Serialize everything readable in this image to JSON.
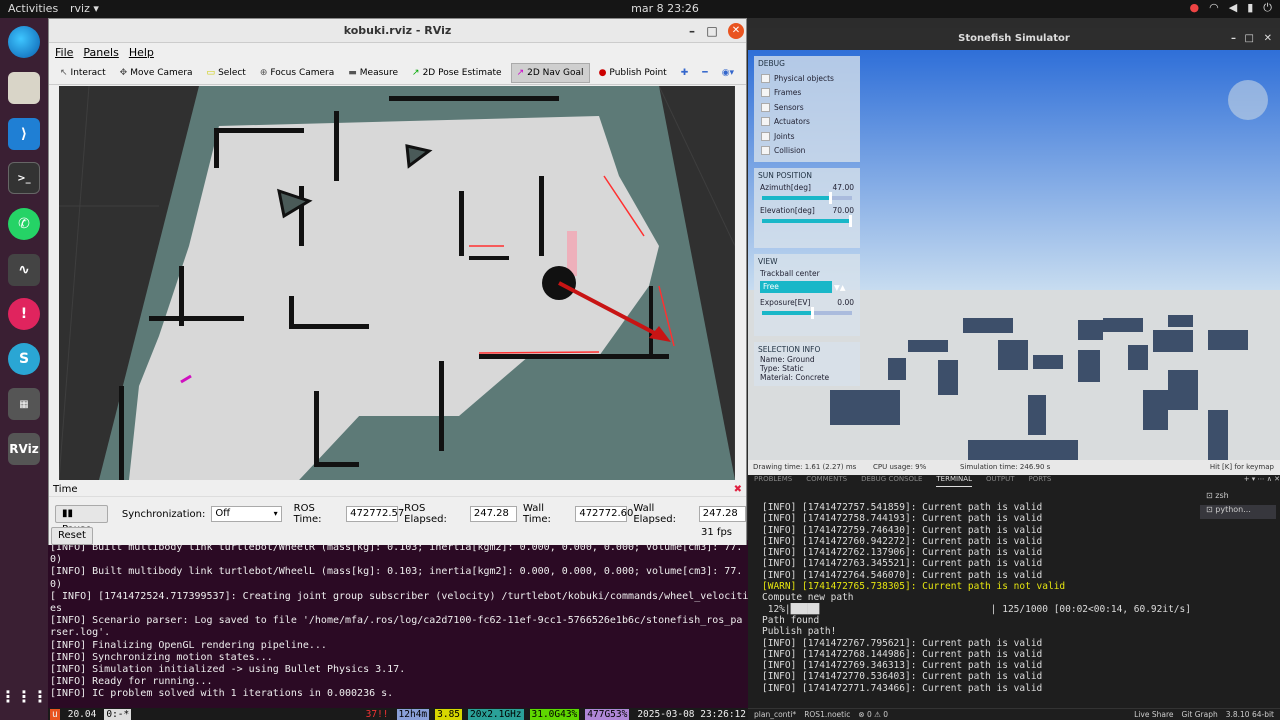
{
  "topbar": {
    "activities": "Activities",
    "app_name": "rviz ▾",
    "clock": "mar 8  23:26"
  },
  "dock": {
    "items": [
      "Edge",
      "Files",
      "VS Code",
      "Terminal",
      "WhatsApp",
      "System Monitor",
      "Alert",
      "Stonefish",
      "Apps",
      "RViz"
    ],
    "rviz_label": "RViz",
    "grid_label": "⋮⋮⋮"
  },
  "rviz": {
    "title": "kobuki.rviz - RViz",
    "menu": {
      "file": "File",
      "panels": "Panels",
      "help": "Help"
    },
    "tools": [
      "Interact",
      "Move Camera",
      "Select",
      "Focus Camera",
      "Measure",
      "2D Pose Estimate",
      "2D Nav Goal",
      "Publish Point"
    ],
    "active_tool": "2D Nav Goal",
    "time": {
      "header": "Time",
      "pause": "Pause",
      "sync_label": "Synchronization:",
      "sync_value": "Off",
      "ros_time_label": "ROS Time:",
      "ros_time": "472772.57",
      "ros_elapsed_label": "ROS Elapsed:",
      "ros_elapsed": "247.28",
      "wall_time_label": "Wall Time:",
      "wall_time": "472772.60",
      "wall_elapsed_label": "Wall Elapsed:",
      "wall_elapsed": "247.28",
      "reset": "Reset",
      "fps": "31 fps"
    }
  },
  "terminal_left": {
    "lines": [
      "[INFO] Built multibody link turtlebot/WheelR (mass[kg]: 0.103; inertia[kgm2]: 0.000, 0.000, 0.000; volume[cm3]: 77.",
      "0)",
      "[INFO] Built multibody link turtlebot/WheelL (mass[kg]: 0.103; inertia[kgm2]: 0.000, 0.000, 0.000; volume[cm3]: 77.",
      "0)",
      "[ INFO] [1741472524.717399537]: Creating joint group subscriber (velocity) /turtlebot/kobuki/commands/wheel_velociti",
      "es",
      "[INFO] Scenario parser: Log saved to file '/home/mfa/.ros/log/ca2d7100-fc62-11ef-9cc1-5766526e1b6c/stonefish_ros_pa",
      "rser.log'.",
      "[INFO] Finalizing OpenGL rendering pipeline...",
      "[INFO] Synchronizing motion states...",
      "[INFO] Simulation initialized -> using Bullet Physics 3.17.",
      "[INFO] Ready for running...",
      "[INFO] IC problem solved with 1 iterations in 0.000236 s."
    ]
  },
  "tmux": {
    "items": [
      "u",
      "20.04",
      "0:-*",
      "37!!",
      "12h4m",
      "3.85",
      "20x2.1GHz",
      "31.0G43%",
      "477G53%",
      "2025-03-08 23:26:12"
    ]
  },
  "stonefish": {
    "title": "Stonefish Simulator",
    "debug": {
      "header": "DEBUG",
      "items": [
        "Physical objects",
        "Frames",
        "Sensors",
        "Actuators",
        "Joints",
        "Collision"
      ]
    },
    "sun": {
      "header": "SUN POSITION",
      "azimuth_label": "Azimuth[deg]",
      "azimuth": "47.00",
      "azimuth_frac": 0.75,
      "elevation_label": "Elevation[deg]",
      "elevation": "70.00",
      "elevation_frac": 0.98
    },
    "view": {
      "header": "VIEW",
      "trackball": "Trackball center",
      "mode": "Free",
      "exposure_label": "Exposure[EV]",
      "exposure": "0.00",
      "exposure_frac": 0.55
    },
    "selection": {
      "header": "SELECTION INFO",
      "name": "Name: Ground",
      "type": "Type: Static",
      "material": "Material: Concrete"
    },
    "status": {
      "drawing": "Drawing time: 1.61 (2.27) ms",
      "cpu": "CPU usage: 9%",
      "sim": "Simulation time: 246.90 s",
      "keymap": "Hit [K] for keymap"
    }
  },
  "vscode": {
    "tabs": [
      "PROBLEMS",
      "COMMENTS",
      "DEBUG CONSOLE",
      "TERMINAL",
      "OUTPUT",
      "PORTS"
    ],
    "active_tab": "TERMINAL",
    "sessions": [
      "zsh",
      "python..."
    ],
    "lines": [
      "[INFO] [1741472757.541859]: Current path is valid",
      "[INFO] [1741472758.744193]: Current path is valid",
      "[INFO] [1741472759.746430]: Current path is valid",
      "[INFO] [1741472760.942272]: Current path is valid",
      "[INFO] [1741472762.137906]: Current path is valid",
      "[INFO] [1741472763.345521]: Current path is valid",
      "[INFO] [1741472764.546070]: Current path is valid",
      "[WARN] [1741472765.738305]: Current path is not valid",
      "Compute new path",
      " 12%|█████                              | 125/1000 [00:02<00:14, 60.92it/s]",
      "Path found",
      "Publish path!",
      "[INFO] [1741472767.795621]: Current path is valid",
      "[INFO] [1741472768.144986]: Current path is valid",
      "[INFO] [1741472769.346313]: Current path is valid",
      "[INFO] [1741472770.536403]: Current path is valid",
      "[INFO] [1741472771.743466]: Current path is valid"
    ],
    "statusbar": [
      "plan_conti*",
      "ROS1.noetic",
      "⊗ 0 ⚠ 0",
      "Live Share",
      "Git Graph",
      "3.8.10 64-bit"
    ]
  }
}
